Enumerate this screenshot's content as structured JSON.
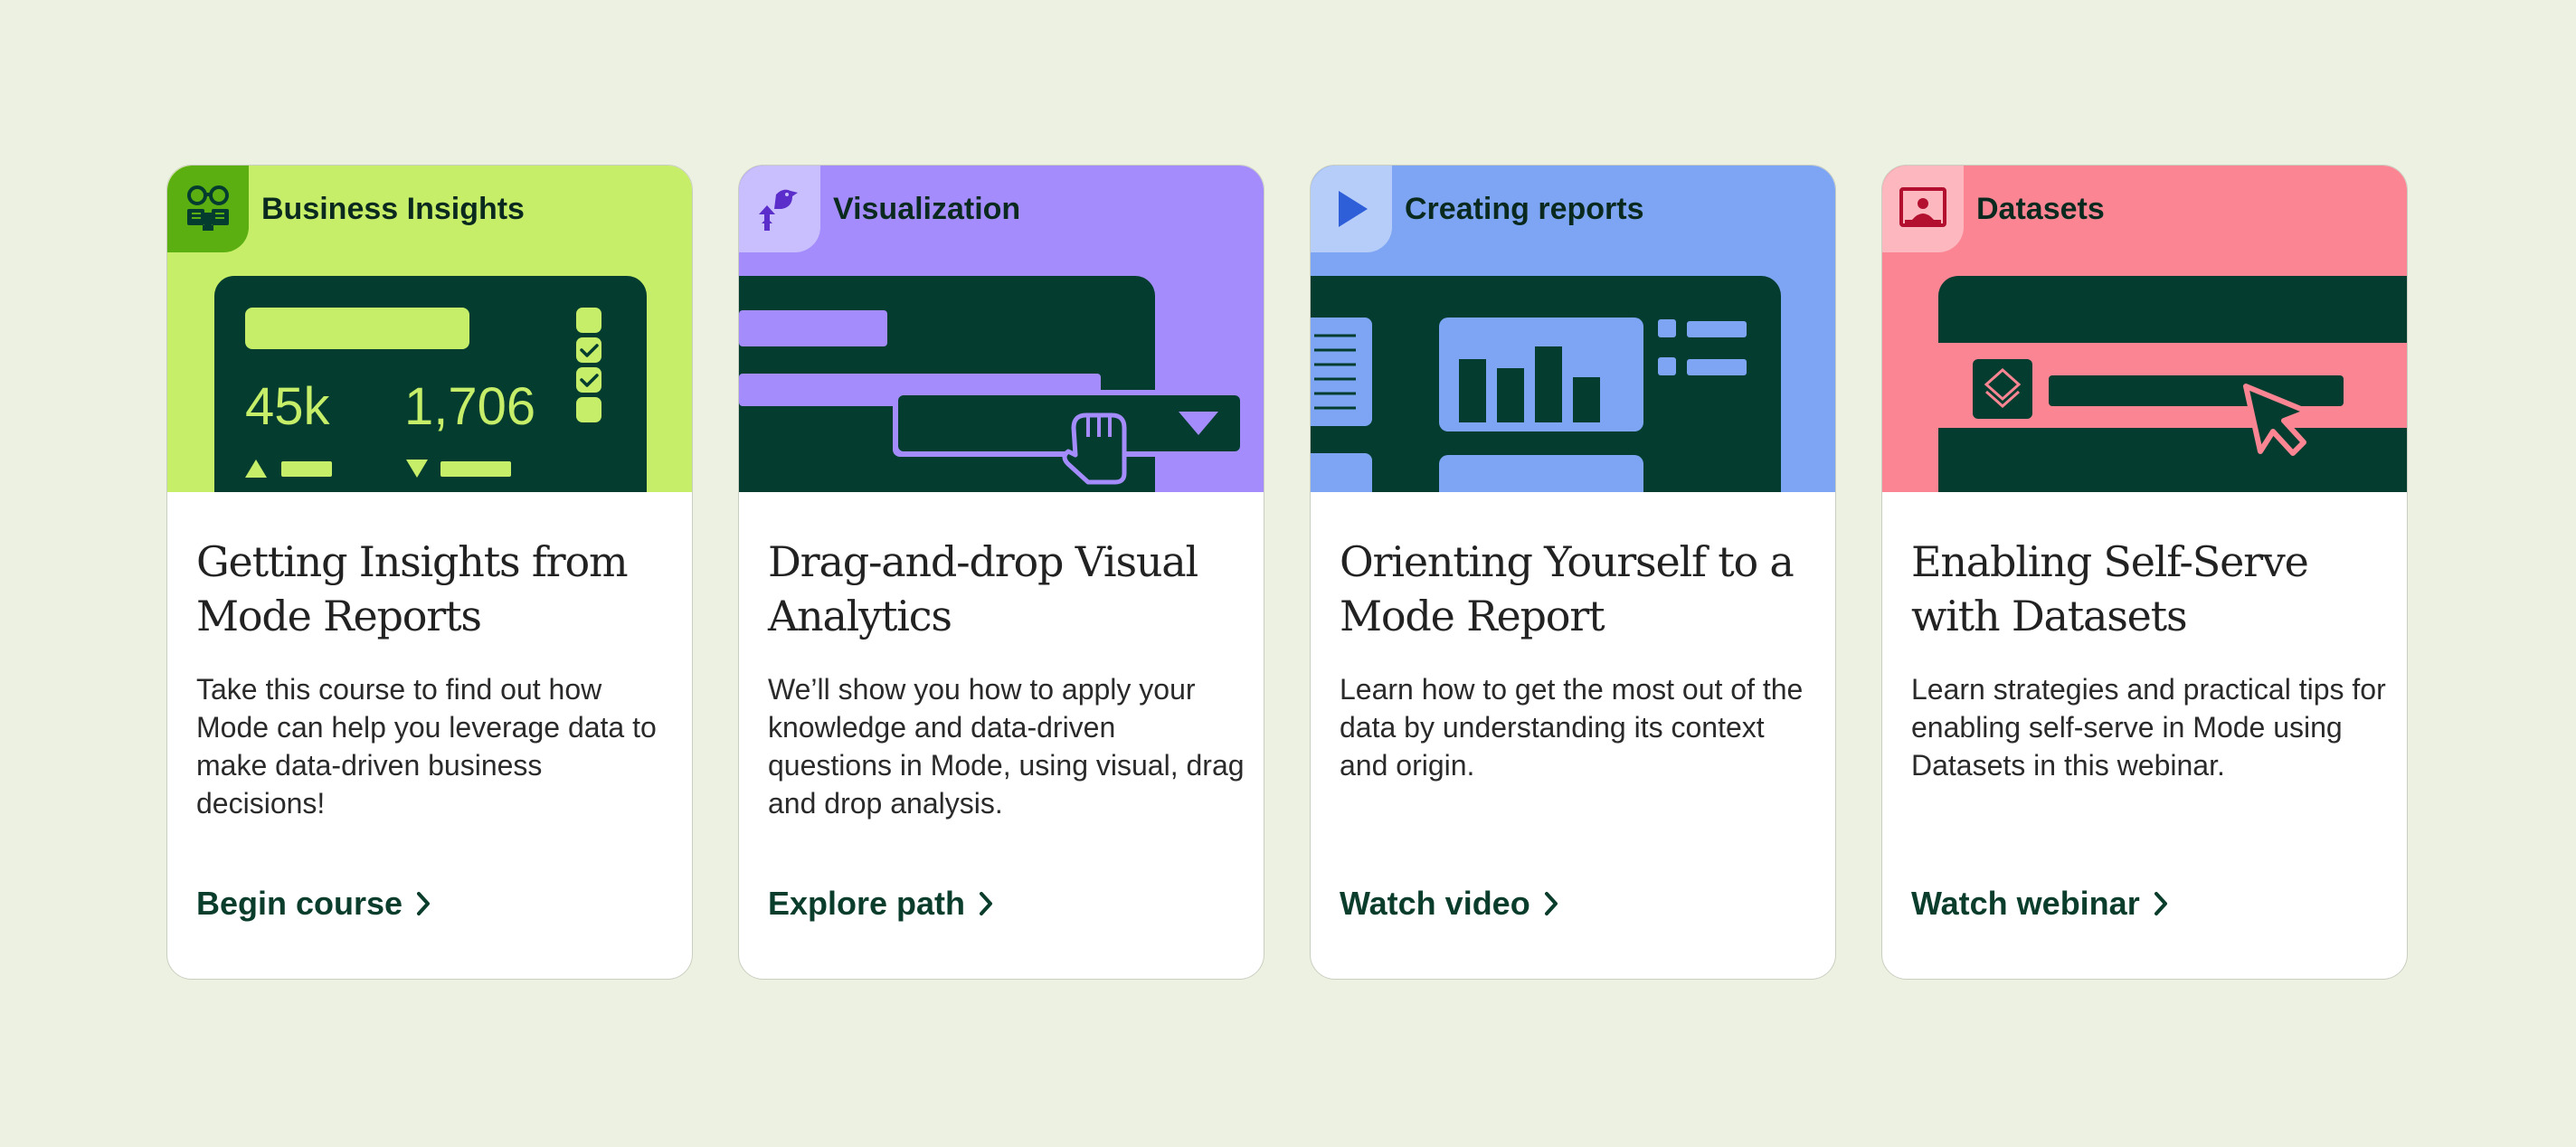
{
  "colors": {
    "page_background": "#EDF1E2",
    "dark_green": "#043D2F",
    "lime": "#C6EE69",
    "purple": "#A48CFC",
    "blue": "#7DA5F3",
    "pink": "#FB8593",
    "link_text": "#0A3D2B"
  },
  "cards": [
    {
      "category": "Business Insights",
      "category_icon": "binoculars-book-icon",
      "banner_color": "#C6EE69",
      "illustration": "dashboard-metrics-illustration",
      "metric_a": "45k",
      "metric_b": "1,706",
      "title": "Getting Insights from Mode Reports",
      "description": "Take this course to find out how Mode can help you leverage data to make data-driven business decisions!",
      "cta": "Begin course"
    },
    {
      "category": "Visualization",
      "category_icon": "growth-bird-icon",
      "banner_color": "#A48CFC",
      "illustration": "drag-and-drop-illustration",
      "title": "Drag-and-drop Visual Analytics",
      "description": "We’ll show you how to apply your knowledge and data-driven questions in Mode, using visual, drag and drop analysis.",
      "cta": "Explore path"
    },
    {
      "category": "Creating reports",
      "category_icon": "play-icon",
      "banner_color": "#7DA5F3",
      "illustration": "report-bar-chart-illustration",
      "title": "Orienting Yourself to a Mode Report",
      "description": "Learn how to get the most out of the data by understanding its context and origin.",
      "cta": "Watch video"
    },
    {
      "category": "Datasets",
      "category_icon": "presenter-screen-icon",
      "banner_color": "#FB8593",
      "illustration": "dataset-selection-illustration",
      "title": "Enabling Self-Serve with Datasets",
      "description": "Learn strategies and practical tips for enabling self-serve in Mode using Datasets in this webinar.",
      "cta": "Watch webinar"
    }
  ]
}
